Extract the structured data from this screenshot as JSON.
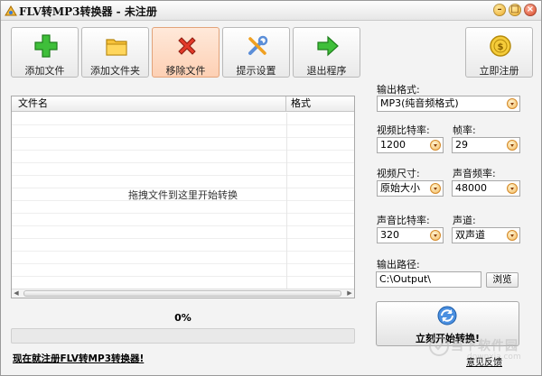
{
  "window": {
    "title": "FLV转MP3转换器 - 未注册"
  },
  "toolbar": {
    "buttons": [
      {
        "label": "添加文件",
        "icon": "plus-icon"
      },
      {
        "label": "添加文件夹",
        "icon": "folder-icon"
      },
      {
        "label": "移除文件",
        "icon": "remove-x-icon"
      },
      {
        "label": "提示设置",
        "icon": "tools-icon"
      },
      {
        "label": "退出程序",
        "icon": "exit-arrow-icon"
      }
    ],
    "register_label": "立即注册"
  },
  "file_list": {
    "columns": [
      "文件名",
      "格式"
    ],
    "empty_hint": "拖拽文件到这里开始转换"
  },
  "progress": {
    "percent_text": "0%",
    "fraction": 0
  },
  "register_link": "现在就注册FLV转MP3转换器!",
  "settings": {
    "output_format_label": "输出格式:",
    "output_format_value": "MP3(纯音频格式)",
    "video_bitrate_label": "视频比特率:",
    "video_bitrate_value": "1200",
    "frame_rate_label": "帧率:",
    "frame_rate_value": "29",
    "video_size_label": "视频尺寸:",
    "video_size_value": "原始大小",
    "audio_sample_rate_label": "声音频率:",
    "audio_sample_rate_value": "48000",
    "audio_bitrate_label": "声音比特率:",
    "audio_bitrate_value": "320",
    "channel_label": "声道:",
    "channel_value": "双声道",
    "output_path_label": "输出路径:",
    "output_path_value": "C:\\Output\\",
    "browse_label": "浏览"
  },
  "start_button_label": "立刻开始转换!",
  "feedback_link": "意见反馈",
  "watermark": {
    "cn": "当下软件园",
    "en": "downxia.com"
  },
  "colors": {
    "active_button_bg": "#fdd0b4",
    "accent_orange": "#f3b85a",
    "progress_fill": "#7fc24a"
  }
}
